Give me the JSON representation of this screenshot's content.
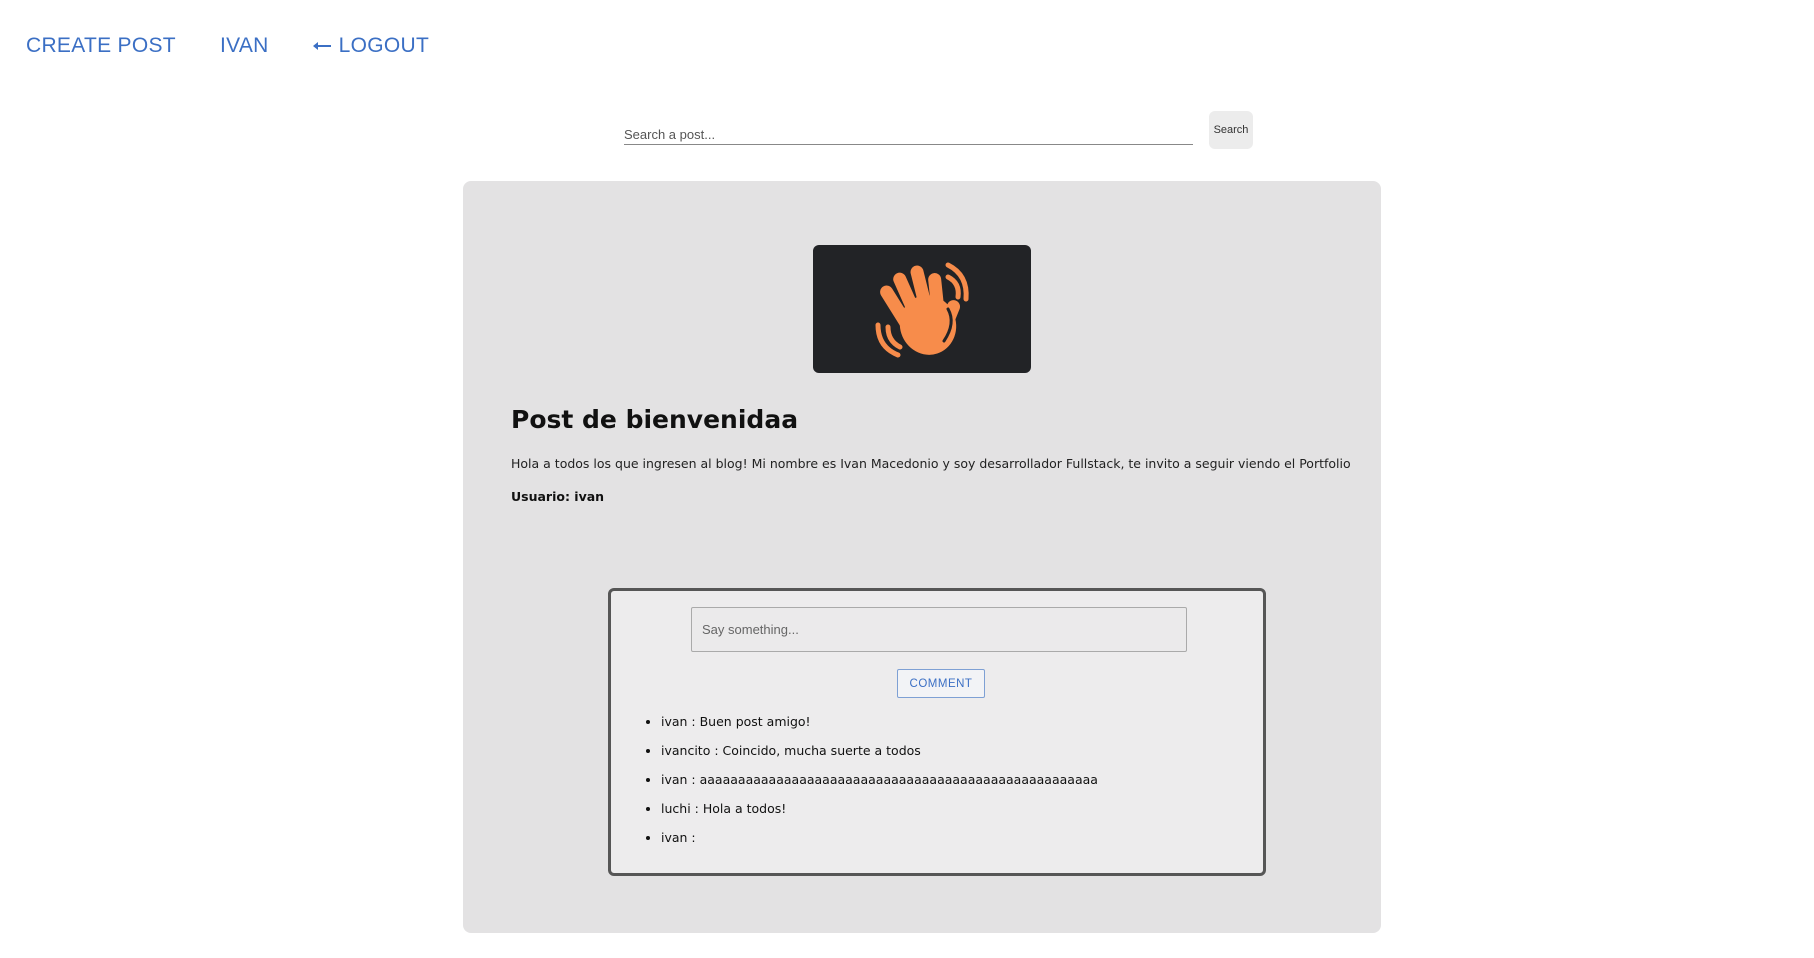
{
  "nav": {
    "create_post": "CREATE POST",
    "user": "IVAN",
    "logout": "LOGOUT"
  },
  "search": {
    "placeholder": "Search a post...",
    "button": "Search"
  },
  "post": {
    "image_icon": "waving-hand-icon",
    "title": "Post de bienvenidaa",
    "body": "Hola a todos los que ingresen al blog! Mi nombre es Ivan Macedonio y soy desarrollador Fullstack, te invito a seguir viendo el Portfolio",
    "user_line": "Usuario: ivan"
  },
  "comments": {
    "placeholder": "Say something...",
    "button": "COMMENT",
    "items": [
      "ivan : Buen post amigo!",
      "ivancito : Coincido, mucha suerte a todos",
      "ivan : aaaaaaaaaaaaaaaaaaaaaaaaaaaaaaaaaaaaaaaaaaaaaaaaaaaa",
      "luchi : Hola a todos!",
      "ivan :"
    ]
  },
  "colors": {
    "link": "#3b6fc4",
    "card_bg": "#e3e2e3",
    "image_bg": "#222326",
    "hand": "#f78c4b"
  }
}
